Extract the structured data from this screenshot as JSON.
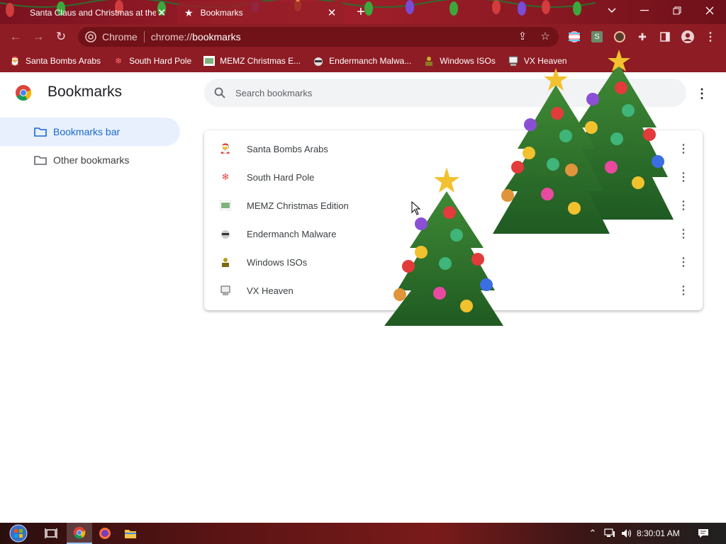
{
  "tabs": [
    {
      "title": "Santa Claus and Christmas at the",
      "active": false
    },
    {
      "title": "Bookmarks",
      "active": true
    }
  ],
  "window_controls": [
    "chevron-down-icon",
    "minimize-icon",
    "restore-icon",
    "close-icon"
  ],
  "omnibox": {
    "site_label": "Chrome",
    "url_scheme": "chrome://",
    "url_host": "bookmarks"
  },
  "bookmarks_bar": [
    {
      "label": "Santa Bombs Arabs",
      "icon": "santa-icon"
    },
    {
      "label": "South Hard Pole",
      "icon": "snowflake-icon"
    },
    {
      "label": "MEMZ Christmas E...",
      "icon": "memz-icon"
    },
    {
      "label": "Endermanch Malwa...",
      "icon": "raccoon-icon"
    },
    {
      "label": "Windows ISOs",
      "icon": "person-icon"
    },
    {
      "label": "VX Heaven",
      "icon": "computer-icon"
    }
  ],
  "page": {
    "title": "Bookmarks",
    "search_placeholder": "Search bookmarks"
  },
  "sidebar": [
    {
      "label": "Bookmarks bar",
      "selected": true
    },
    {
      "label": "Other bookmarks",
      "selected": false
    }
  ],
  "bookmarks": [
    {
      "label": "Santa Bombs Arabs",
      "icon": "santa-icon"
    },
    {
      "label": "South Hard Pole",
      "icon": "snowflake-icon"
    },
    {
      "label": "MEMZ Christmas Edition",
      "icon": "memz-icon"
    },
    {
      "label": "Endermanch Malware",
      "icon": "raccoon-icon"
    },
    {
      "label": "Windows ISOs",
      "icon": "person-icon"
    },
    {
      "label": "VX Heaven",
      "icon": "computer-icon"
    }
  ],
  "taskbar": {
    "clock": "8:30:01 AM",
    "apps": [
      "start-icon",
      "task-view-icon",
      "chrome-icon",
      "firefox-icon",
      "file-explorer-icon"
    ]
  },
  "colors": {
    "accent": "#1967d2",
    "toolbar": "#8e1c24",
    "selected_bg": "#e8f0fe"
  }
}
